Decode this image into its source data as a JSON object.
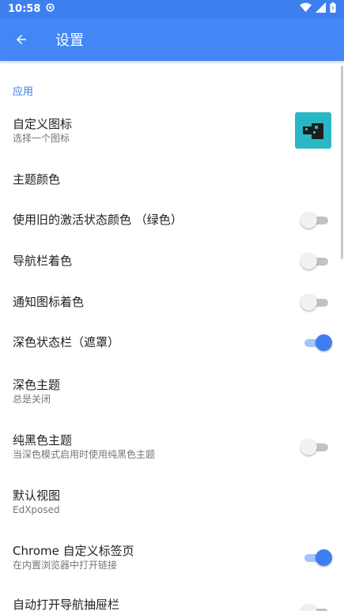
{
  "status_bar": {
    "time": "10:58"
  },
  "app_bar": {
    "title": "设置"
  },
  "section": {
    "header": "应用"
  },
  "settings": [
    {
      "title": "自定义图标",
      "summary": "选择一个图标"
    },
    {
      "title": "主题颜色"
    },
    {
      "title": "使用旧的激活状态颜色 （绿色）",
      "switch": false
    },
    {
      "title": "导航栏着色",
      "switch": false
    },
    {
      "title": "通知图标着色",
      "switch": false
    },
    {
      "title": "深色状态栏（遮罩）",
      "switch": true
    },
    {
      "title": "深色主题",
      "summary": "总是关闭"
    },
    {
      "title": "纯黑色主题",
      "summary": "当深色模式启用时使用纯黑色主题",
      "switch": false
    },
    {
      "title": "默认视图",
      "summary": "EdXposed"
    },
    {
      "title": "Chrome 自定义标签页",
      "summary": "在内置浏览器中打开链接",
      "switch": true
    },
    {
      "title": "自动打开导航抽屉栏",
      "switch": false
    }
  ],
  "colors": {
    "primary": "#4287f5",
    "status_bar": "#3e7ff0",
    "accent": "#3d7ff0",
    "icon_bg": "#2ab7c4"
  }
}
